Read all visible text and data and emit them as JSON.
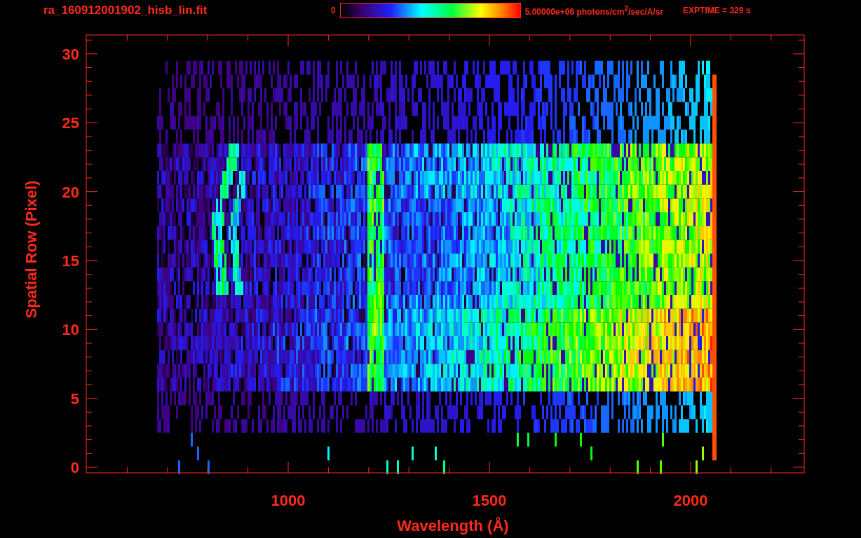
{
  "header": {
    "title": "ra_160912001902_hisb_lin.fit",
    "colorbar": {
      "min_label": "0",
      "max_label": "5.00000e+06 photons/cm$^{2}$/sec/A/sr"
    },
    "exposure": "EXPTIME = 329 s"
  },
  "plot": {
    "xlabel": "Wavelength (Å)",
    "ylabel": "Spatial Row (Pixel)",
    "xticks": [
      "1000",
      "1500",
      "2000"
    ],
    "yticks": [
      "30",
      "25",
      "20",
      "15",
      "10",
      "5",
      "0"
    ]
  }
}
